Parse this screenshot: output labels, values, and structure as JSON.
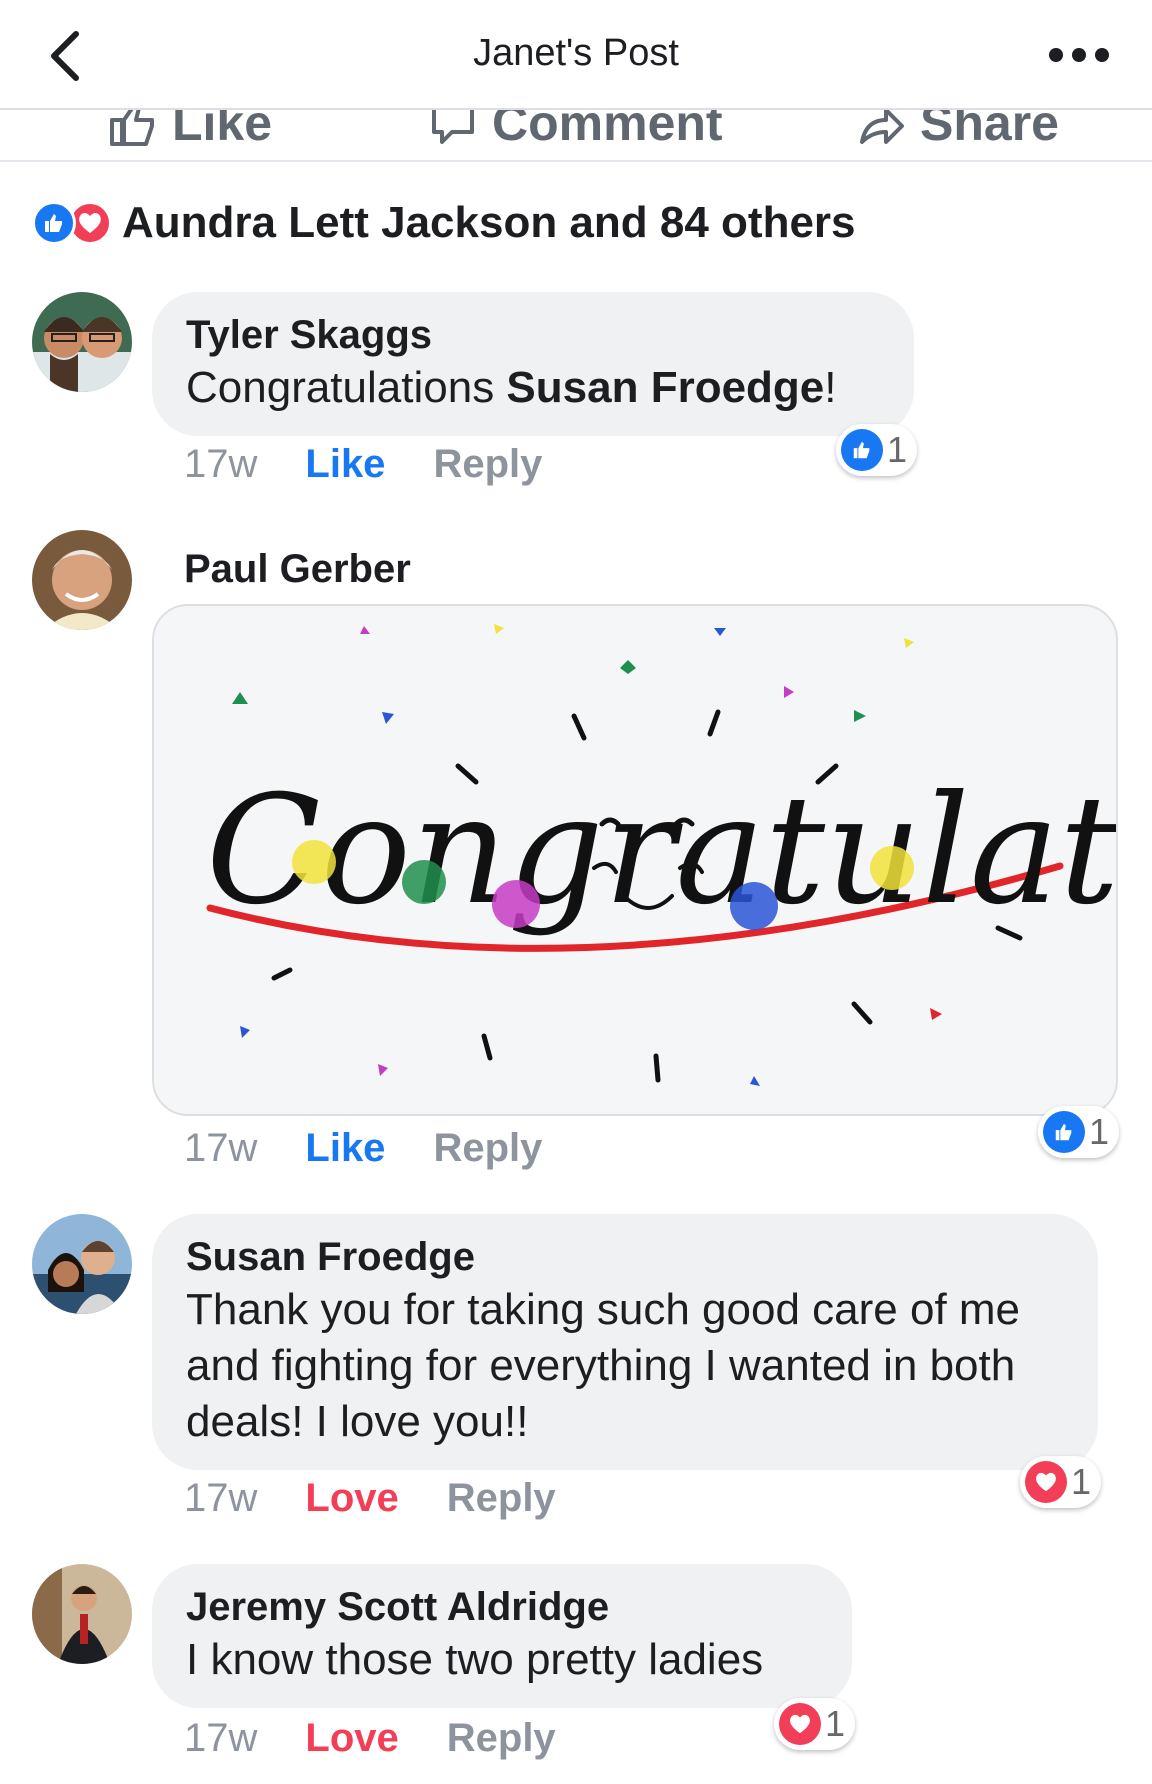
{
  "header": {
    "title": "Janet's Post",
    "back_icon": "chevron-left-icon",
    "more_icon": "more-dots-icon"
  },
  "actions": {
    "like": "Like",
    "comment": "Comment",
    "share": "Share"
  },
  "reactions_summary": {
    "text": "Aundra Lett Jackson and 84 others"
  },
  "comments": [
    {
      "author": "Tyler Skaggs",
      "text": "Congratulations ",
      "mention": "Susan Froedge",
      "text_after": "!",
      "time": "17w",
      "action": "Like",
      "reply": "Reply",
      "reaction_type": "like",
      "reaction_count": "1"
    },
    {
      "author": "Paul Gerber",
      "image_text": "Congratulations!",
      "time": "17w",
      "action": "Like",
      "reply": "Reply",
      "reaction_type": "like",
      "reaction_count": "1"
    },
    {
      "author": "Susan Froedge",
      "text": "Thank you for taking such good care of me and fighting for everything I wanted in both deals!  I love you!!",
      "time": "17w",
      "action": "Love",
      "reply": "Reply",
      "reaction_type": "love",
      "reaction_count": "1"
    },
    {
      "author": "Jeremy Scott Aldridge",
      "text": "I know those two pretty ladies",
      "time": "17w",
      "action": "Love",
      "reply": "Reply",
      "reaction_type": "love",
      "reaction_count": "1"
    }
  ],
  "colors": {
    "facebook_blue": "#1877f2",
    "love_red": "#f33e58",
    "bubble_gray": "#eff1f3",
    "meta_gray": "#8d949e"
  }
}
